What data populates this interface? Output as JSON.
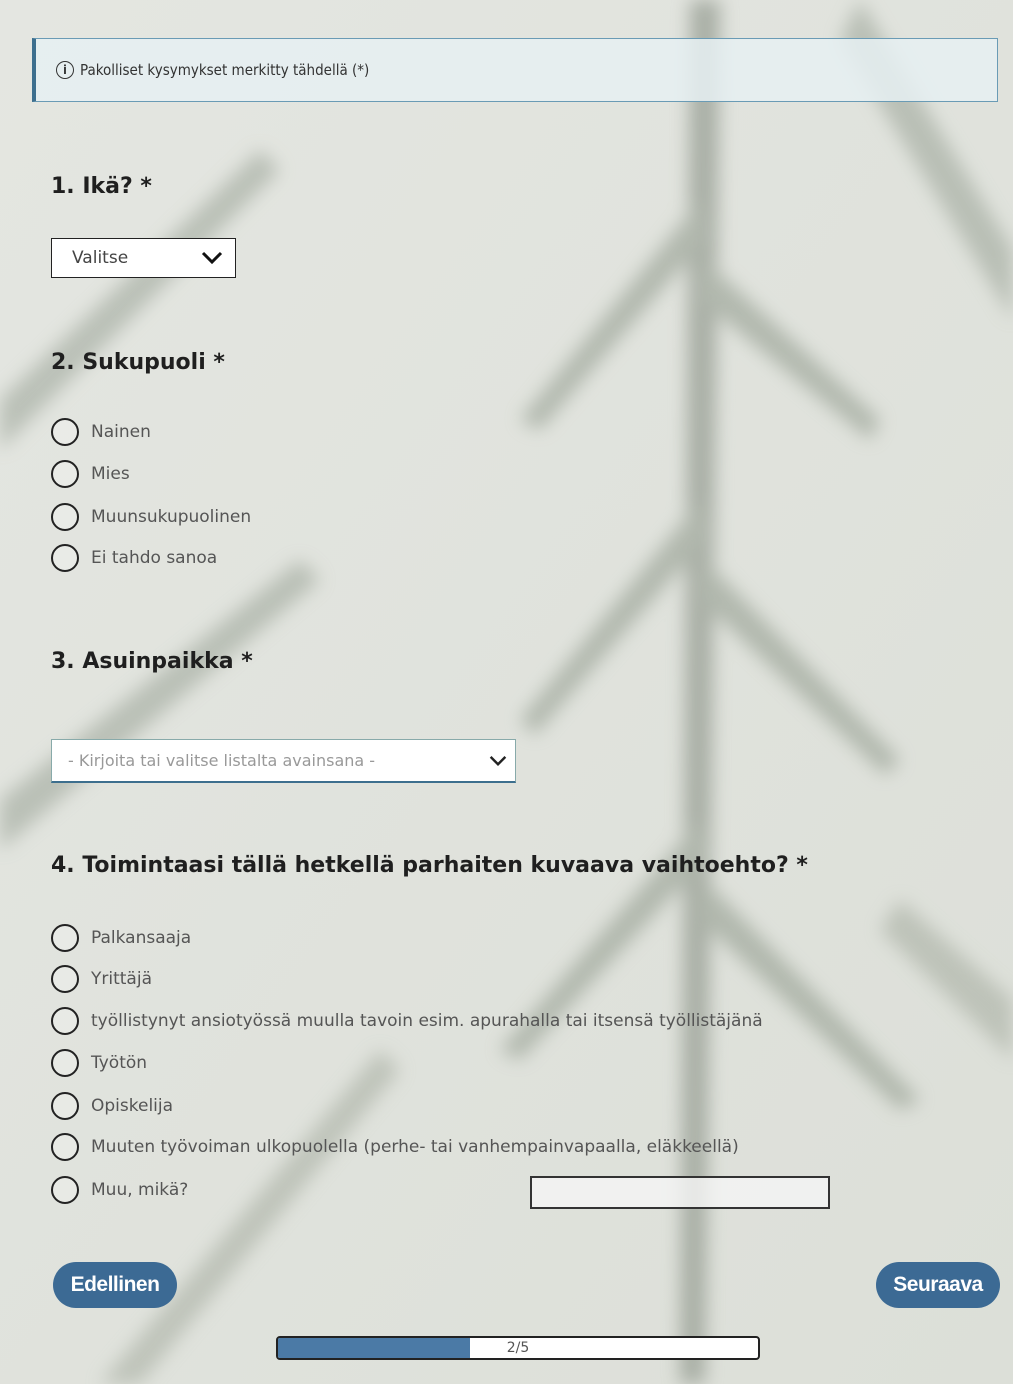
{
  "notice": {
    "text": "Pakolliset kysymykset merkitty tähdellä (*)"
  },
  "q1": {
    "title": "1. Ikä? *",
    "select_value": "Valitse"
  },
  "q2": {
    "title": "2. Sukupuoli *",
    "options": [
      "Nainen",
      "Mies",
      "Muunsukupuolinen",
      "Ei tahdo sanoa"
    ]
  },
  "q3": {
    "title": "3. Asuinpaikka *",
    "placeholder": "- Kirjoita tai valitse listalta avainsana -"
  },
  "q4": {
    "title": "4. Toimintaasi tällä hetkellä parhaiten kuvaava vaihtoehto? *",
    "options": [
      "Palkansaaja",
      "Yrittäjä",
      "työllistynyt ansiotyössä muulla tavoin esim. apurahalla tai itsensä työllistäjänä",
      "Työtön",
      "Opiskelija",
      "Muuten työvoiman ulkopuolella (perhe- tai vanhempainvapaalla, eläkkeellä)",
      "Muu, mikä?"
    ]
  },
  "nav": {
    "prev_label": "Edellinen",
    "next_label": "Seuraava"
  },
  "progress": {
    "label": "2/5",
    "current": 2,
    "total": 5,
    "fill_color": "#4b7aa6"
  },
  "colors": {
    "accent": "#3c6a94",
    "notice_border": "#3d6f8e"
  },
  "icons": {
    "notice": "info-icon",
    "select": "chevron-down-icon"
  }
}
